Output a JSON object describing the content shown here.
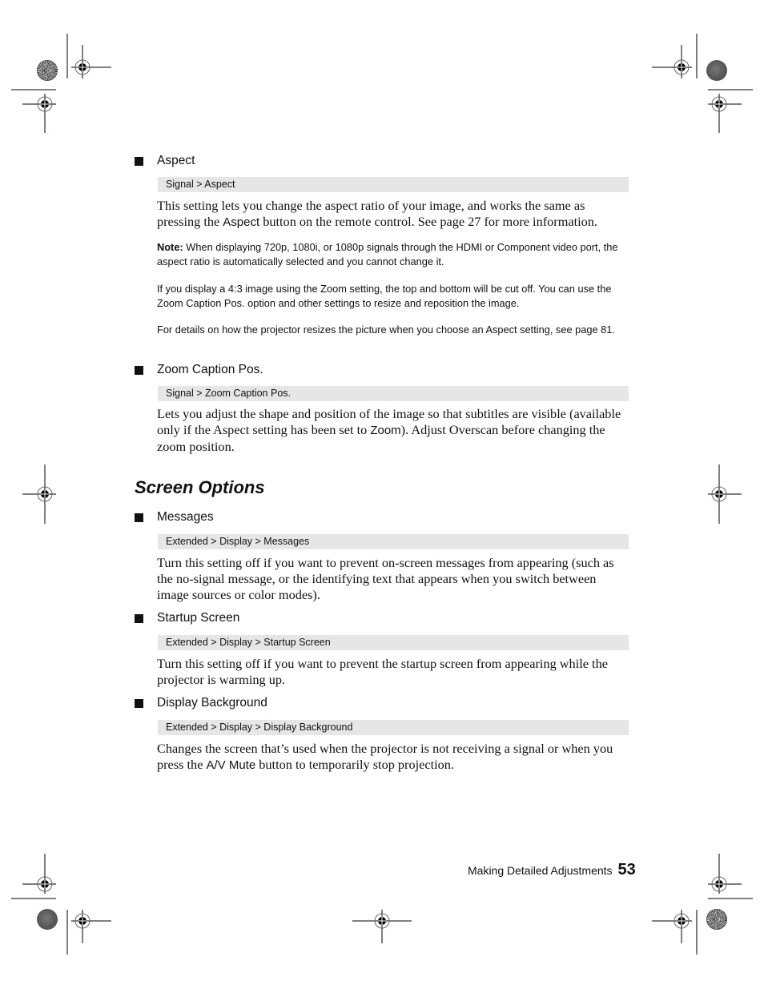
{
  "items": [
    {
      "title": "Aspect",
      "menu_path": "Signal > Aspect",
      "body": [
        {
          "t": "This setting lets you change the aspect ratio of your image, and works the same as pressing the "
        },
        {
          "ui": "Aspect"
        },
        {
          "t": " button on the remote control. See page 27 for more information."
        }
      ],
      "notes": [
        {
          "label": "Note:",
          "text": " When displaying 720p, 1080i, or 1080p signals through the HDMI or Component video port, the aspect ratio is automatically selected and you cannot change it."
        },
        {
          "label": "",
          "text": "If you display a 4:3 image using the Zoom setting, the top and bottom will be cut off. You can use the Zoom Caption Pos. option and other settings to resize and reposition the image."
        },
        {
          "label": "",
          "text": "For details on how the projector resizes the picture when you choose an Aspect setting, see page 81."
        }
      ]
    },
    {
      "title": "Zoom Caption Pos.",
      "menu_path": "Signal > Zoom Caption Pos.",
      "body": [
        {
          "t": "Lets you adjust the shape and position of the image so that subtitles are visible (available only if the Aspect setting has been set to "
        },
        {
          "ui": "Zoom"
        },
        {
          "t": "). Adjust Overscan before changing the zoom position."
        }
      ]
    }
  ],
  "section": {
    "title": "Screen Options",
    "items": [
      {
        "title": "Messages",
        "menu_path": "Extended > Display > Messages",
        "body": [
          {
            "t": "Turn this setting off if you want to prevent on-screen messages from appearing (such as the no-signal message, or the identifying text that appears when you switch between image sources or color modes)."
          }
        ]
      },
      {
        "title": "Startup Screen",
        "menu_path": "Extended > Display > Startup Screen",
        "body": [
          {
            "t": "Turn this setting off if you want to prevent the startup screen from appearing while the projector is warming up."
          }
        ]
      },
      {
        "title": "Display Background",
        "menu_path": "Extended > Display > Display Background",
        "body": [
          {
            "t": "Changes the screen that’s used when the projector is not receiving a signal or when you press the "
          },
          {
            "ui": "A/V Mute"
          },
          {
            "t": " button to temporarily stop projection."
          }
        ]
      }
    ]
  },
  "footer": {
    "chapter": "Making Detailed Adjustments",
    "page_number": "53"
  }
}
